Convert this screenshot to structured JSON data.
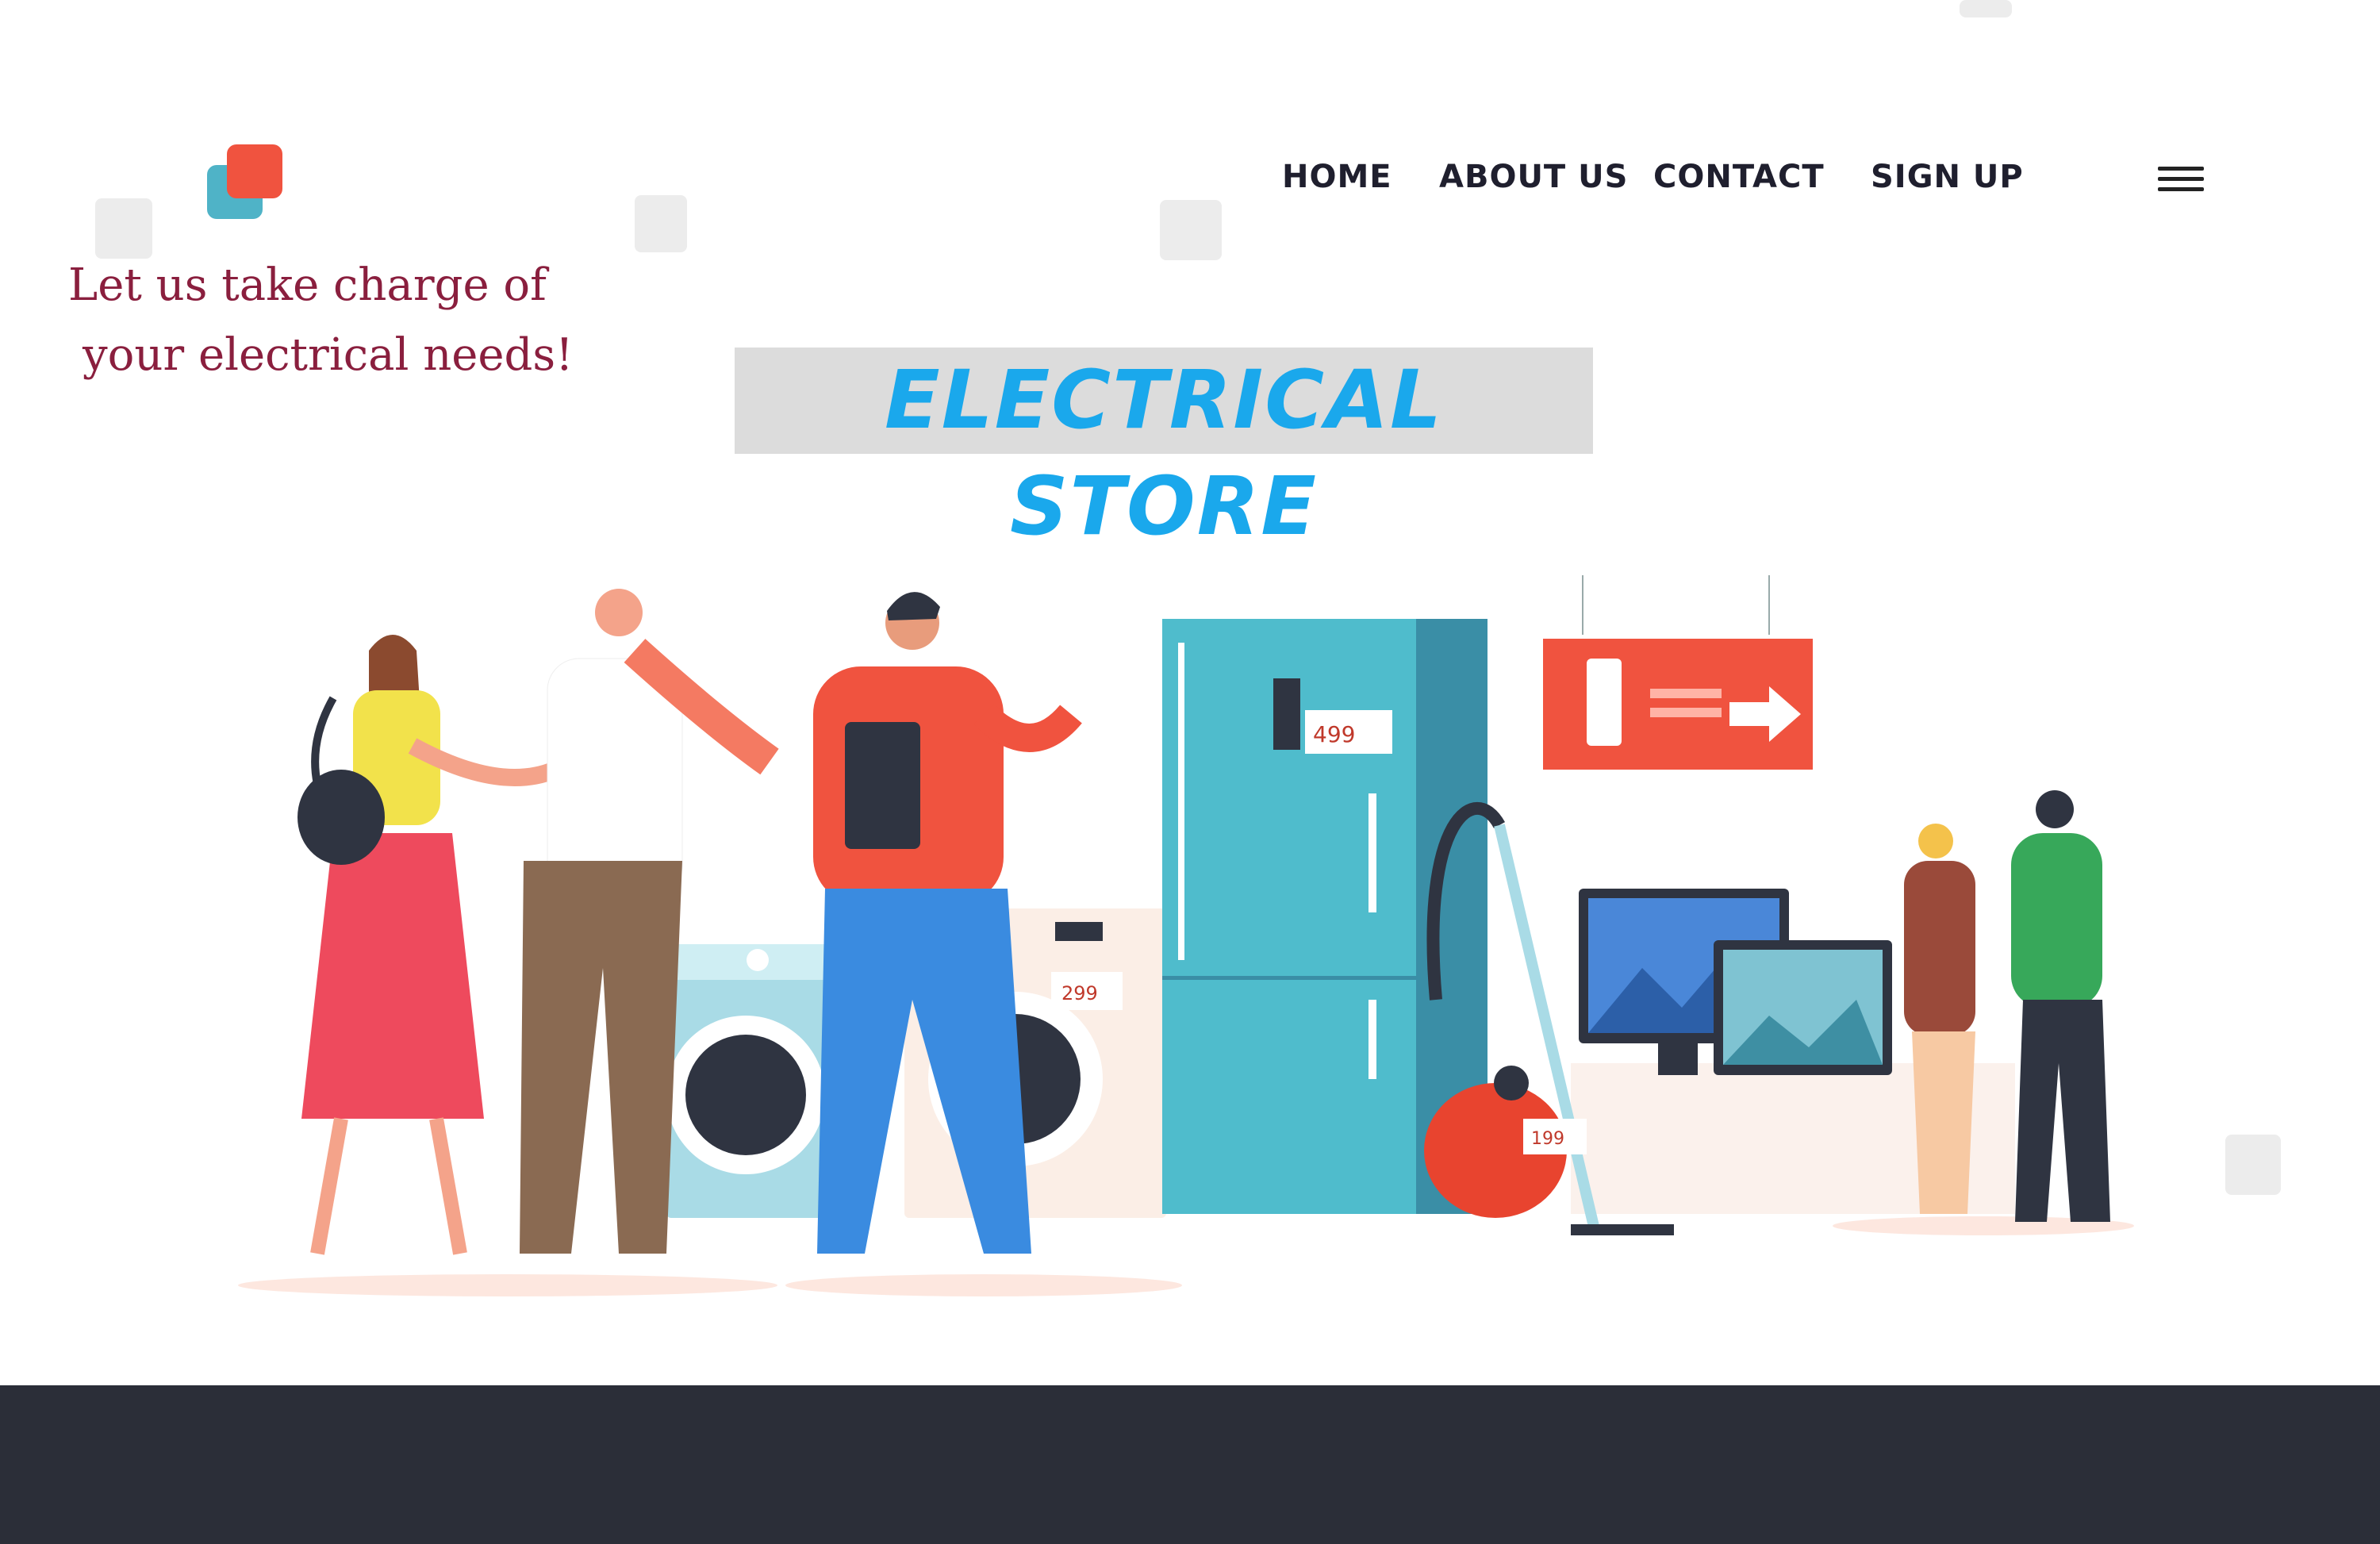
{
  "brand": {
    "tagline_line1": "Let us take charge of",
    "tagline_line2": "your electrical needs!",
    "logo_colors": [
      "#4fb3c7",
      "#f0533f"
    ]
  },
  "nav": {
    "items": [
      {
        "label": "HOME"
      },
      {
        "label": "ABOUT US"
      },
      {
        "label": "CONTACT"
      },
      {
        "label": "SIGN UP"
      }
    ],
    "menu_icon": "hamburger-menu-icon"
  },
  "hero": {
    "title": "ELECTRICAL STORE",
    "title_color": "#1aa8ec",
    "price_tags": [
      "499",
      "299",
      "199"
    ]
  },
  "colors": {
    "footer": "#2b2e38",
    "accent_red": "#f0533f",
    "fridge": "#4fbccc"
  }
}
